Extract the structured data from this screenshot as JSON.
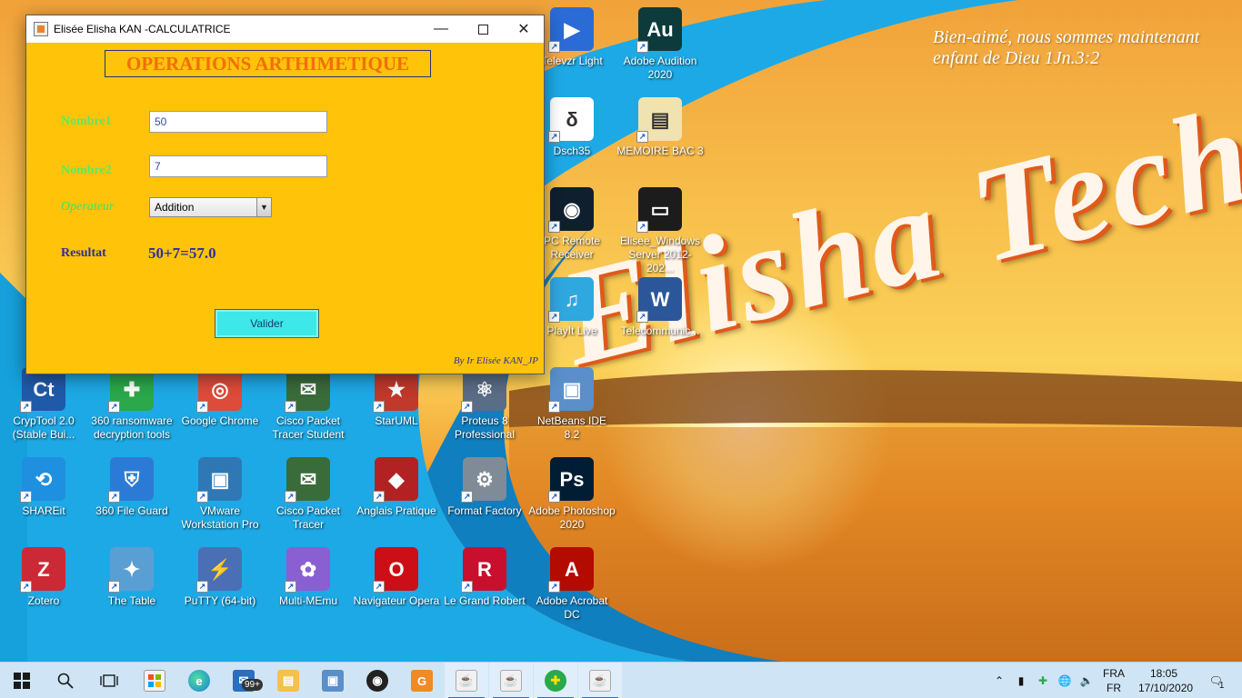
{
  "desktop": {
    "quote": "Bien-aimé, nous sommes maintenant enfant de Dieu 1Jn.3:2",
    "brand": "Elisha Tech",
    "icons": [
      {
        "label": "Televzr Light",
        "icon": "televzr-icon",
        "color": "#2b6bd6",
        "glyph": "▶"
      },
      {
        "label": "Adobe Audition 2020",
        "icon": "adobe-audition-icon",
        "color": "#0d3b3b",
        "glyph": "Au"
      },
      {
        "label": "Dsch35",
        "icon": "dsch-icon",
        "color": "#ffffff",
        "glyph": "δ"
      },
      {
        "label": "MEMOIRE BAC 3",
        "icon": "folder-icon",
        "color": "#f0e3b0",
        "glyph": "▤"
      },
      {
        "label": "PC Remote Receiver",
        "icon": "pc-remote-icon",
        "color": "#0f1f2d",
        "glyph": "◉"
      },
      {
        "label": "Elisee_Windows Server 2012-202...",
        "icon": "windows-server-icon",
        "color": "#1c1c1c",
        "glyph": "▭"
      },
      {
        "label": "PlayIt Live",
        "icon": "playit-live-icon",
        "color": "#2fa7df",
        "glyph": "♫"
      },
      {
        "label": "Telecommunic...",
        "icon": "word-document-icon",
        "color": "#2b579a",
        "glyph": "W"
      },
      {
        "label": "CrypTool 2.0 (Stable Bui...",
        "icon": "cryptool-icon",
        "color": "#1f5aa8",
        "glyph": "Ct"
      },
      {
        "label": "360 ransomware decryption tools",
        "icon": "360-ransomware-icon",
        "color": "#2aa84a",
        "glyph": "✚"
      },
      {
        "label": "Google Chrome",
        "icon": "chrome-icon",
        "color": "#dd4b39",
        "glyph": "◎"
      },
      {
        "label": "Cisco Packet Tracer Student",
        "icon": "cisco-student-icon",
        "color": "#3a6b3a",
        "glyph": "✉"
      },
      {
        "label": "StarUML",
        "icon": "staruml-icon",
        "color": "#c0392b",
        "glyph": "★"
      },
      {
        "label": "Proteus 8 Professional",
        "icon": "proteus-icon",
        "color": "#5a6d86",
        "glyph": "⚛"
      },
      {
        "label": "NetBeans IDE 8.2",
        "icon": "netbeans-icon",
        "color": "#5a8fc9",
        "glyph": "▣"
      },
      {
        "label": "SHAREit",
        "icon": "shareit-icon",
        "color": "#1f8fe0",
        "glyph": "⟲"
      },
      {
        "label": "360 File Guard",
        "icon": "360-file-guard-icon",
        "color": "#2b7bd6",
        "glyph": "⛨"
      },
      {
        "label": "VMware Workstation Pro",
        "icon": "vmware-icon",
        "color": "#2f78b5",
        "glyph": "▣"
      },
      {
        "label": "Cisco Packet Tracer",
        "icon": "cisco-packet-tracer-icon",
        "color": "#3a6b3a",
        "glyph": "✉"
      },
      {
        "label": "Anglais Pratique",
        "icon": "anglais-pratique-icon",
        "color": "#b22222",
        "glyph": "◆"
      },
      {
        "label": "Format Factory",
        "icon": "format-factory-icon",
        "color": "#7f8b96",
        "glyph": "⚙"
      },
      {
        "label": "Adobe Photoshop 2020",
        "icon": "adobe-photoshop-icon",
        "color": "#001d34",
        "glyph": "Ps"
      },
      {
        "label": "Zotero",
        "icon": "zotero-icon",
        "color": "#cc2936",
        "glyph": "Z"
      },
      {
        "label": "The Table",
        "icon": "the-table-icon",
        "color": "#5a9fd4",
        "glyph": "✦"
      },
      {
        "label": "PuTTY (64-bit)",
        "icon": "putty-icon",
        "color": "#4a6fb5",
        "glyph": "⚡"
      },
      {
        "label": "Multi-MEmu",
        "icon": "multi-memu-icon",
        "color": "#8a5fd1",
        "glyph": "✿"
      },
      {
        "label": "Navigateur Opera",
        "icon": "opera-icon",
        "color": "#cc0f16",
        "glyph": "O"
      },
      {
        "label": "Le Grand Robert",
        "icon": "le-grand-robert-icon",
        "color": "#c8102e",
        "glyph": "R"
      },
      {
        "label": "Adobe Acrobat DC",
        "icon": "adobe-acrobat-icon",
        "color": "#b30b00",
        "glyph": "A"
      }
    ]
  },
  "window": {
    "title": "Elisée Elisha KAN -CALCULATRICE",
    "heading": "OPERATIONS ARTHIMETIQUE",
    "nombre1_label": "Nombre1",
    "nombre1_value": "50",
    "nombre2_label": "Nombre2",
    "nombre2_value": "7",
    "operateur_label": "Operateur",
    "operateur_selected": "Addition",
    "resultat_label": "Resultat",
    "resultat_value": "50+7=57.0",
    "valider_label": "Valider",
    "credit": "By Ir Elisée KAN_JP",
    "colors": {
      "background": "#ffc30a",
      "heading": "#f26f0a",
      "labels": "#5ee85e",
      "result": "#2b2f9b",
      "button": "#3ee8e8"
    }
  },
  "taskbar": {
    "pinned": [
      {
        "name": "start",
        "icon": "windows-start-icon"
      },
      {
        "name": "search",
        "icon": "search-icon"
      },
      {
        "name": "task-view",
        "icon": "task-view-icon"
      },
      {
        "name": "store",
        "icon": "microsoft-store-icon"
      },
      {
        "name": "edge",
        "icon": "edge-icon"
      },
      {
        "name": "mail",
        "icon": "mail-icon",
        "badge": "99+"
      },
      {
        "name": "file-explorer",
        "icon": "folder-icon"
      },
      {
        "name": "virtualbox",
        "icon": "virtualbox-icon"
      },
      {
        "name": "media",
        "icon": "record-icon"
      },
      {
        "name": "pdf",
        "icon": "pdf-icon"
      },
      {
        "name": "java-1",
        "icon": "java-icon"
      },
      {
        "name": "java-2",
        "icon": "java-icon"
      },
      {
        "name": "360",
        "icon": "360-icon"
      },
      {
        "name": "java-3",
        "icon": "java-icon"
      }
    ],
    "lang_top": "FRA",
    "lang_bottom": "FR",
    "time": "18:05",
    "date": "17/10/2020",
    "notification_count": "1"
  }
}
